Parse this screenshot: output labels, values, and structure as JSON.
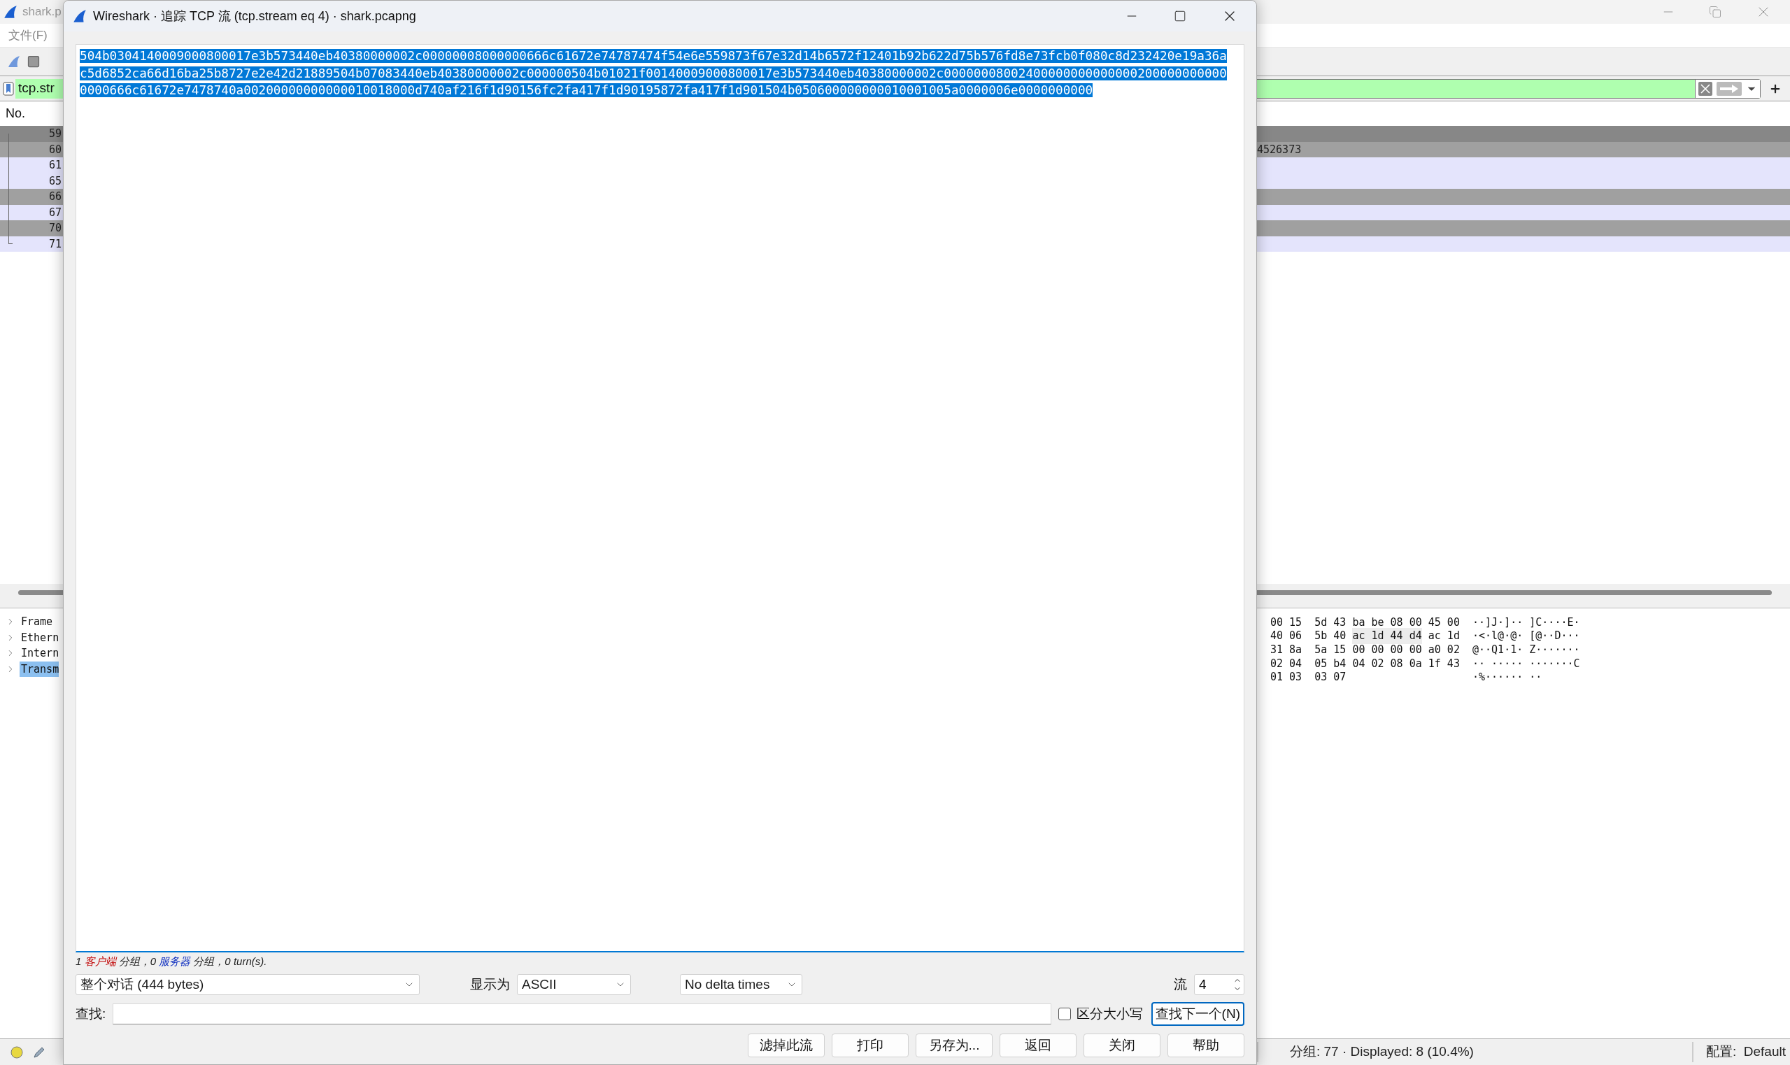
{
  "main_window": {
    "title": "shark.p",
    "menu": [
      "文件(F)"
    ],
    "filter": {
      "value": "tcp.str"
    },
    "packet_list": {
      "column": "No.",
      "rows": [
        {
          "no": "59",
          "color": "#878787",
          "cell": ""
        },
        {
          "no": "60",
          "color": "#a0a0a0",
          "cell": "4526373"
        },
        {
          "no": "61",
          "color": "#e4e4fc",
          "cell": ""
        },
        {
          "no": "65",
          "color": "#e4e4fc",
          "cell": ""
        },
        {
          "no": "66",
          "color": "#a0a0a0",
          "cell": ""
        },
        {
          "no": "67",
          "color": "#e4e4fc",
          "cell": ""
        },
        {
          "no": "70",
          "color": "#a0a0a0",
          "cell": ""
        },
        {
          "no": "71",
          "color": "#e4e4fc",
          "cell": ""
        }
      ]
    },
    "details": [
      {
        "label": "Frame",
        "selected": false
      },
      {
        "label": "Ethern",
        "selected": false
      },
      {
        "label": "Intern",
        "selected": false
      },
      {
        "label": "Transm",
        "selected": true
      }
    ],
    "bytes": [
      {
        "hex": [
          {
            "text": "00 15  5d 43 ba be 08 00 45 00",
            "selected": false
          }
        ],
        "ascii": "··]J·]·· ]C····E·"
      },
      {
        "hex": [
          {
            "text": "40 06  5b 40 ",
            "selected": false
          },
          {
            "text": "ac 1d 44 d4",
            "selected": true
          },
          {
            "text": " ac 1d",
            "selected": false
          }
        ],
        "ascii": "·<·l@·@· [@··D···"
      },
      {
        "hex": [
          {
            "text": "31 8a  5a 15 00 00 00 00 a0 02",
            "selected": false
          }
        ],
        "ascii": "@··Q1·1· Z·······"
      },
      {
        "hex": [
          {
            "text": "02 04  05 b4 04 02 08 0a 1f 43",
            "selected": false
          }
        ],
        "ascii": "·· ····· ·······C"
      },
      {
        "hex": [
          {
            "text": "01 03  03 07",
            "selected": false
          }
        ],
        "ascii": "·%······ ··"
      }
    ],
    "status": {
      "packets": "分组: 77 · Displayed: 8 (10.4%)",
      "profile": "配置:  Default"
    }
  },
  "dialog": {
    "title": "Wireshark · 追踪 TCP 流 (tcp.stream eq 4) · shark.pcapng",
    "stream": {
      "selected": true,
      "lines": [
        "504b0304140009000800017e3b573440eb40380000002c00000008000000666c61672e74787474f54e6e559873f67e32d14b6572f12401b92b622d75b576fd8e73fcb0f080c8d232420e19a36a",
        "c5d6852ca66d16ba25b8727e2e42d21889504b07083440eb40380000002c000000504b01021f00140009000800017e3b573440eb40380000002c00000008002400000000000000200000000000",
        "0000666c61672e7478740a00200000000000010018000d740af216f1d90156fc2fa417f1d90195872fa417f1d901504b050600000000010001005a0000006e0000000000"
      ]
    },
    "summary": [
      {
        "kind": "plain",
        "text": "1 "
      },
      {
        "kind": "client",
        "text": "客户端"
      },
      {
        "kind": "plain",
        "text": " 分组，0 "
      },
      {
        "kind": "server",
        "text": "服务器"
      },
      {
        "kind": "plain",
        "text": " 分组，0 turn(s)."
      }
    ],
    "conversation": "整个对话 (444 bytes)",
    "show_as_label": "显示为",
    "show_as": "ASCII",
    "delta": "No delta times",
    "stream_label": "流",
    "stream_number": "4",
    "find_label": "查找:",
    "case_sensitive": {
      "label": "区分大小写",
      "checked": false
    },
    "find_next": "查找下一个(N)",
    "buttons": [
      "滤掉此流",
      "打印",
      "另存为...",
      "返回",
      "关闭",
      "帮助"
    ]
  }
}
